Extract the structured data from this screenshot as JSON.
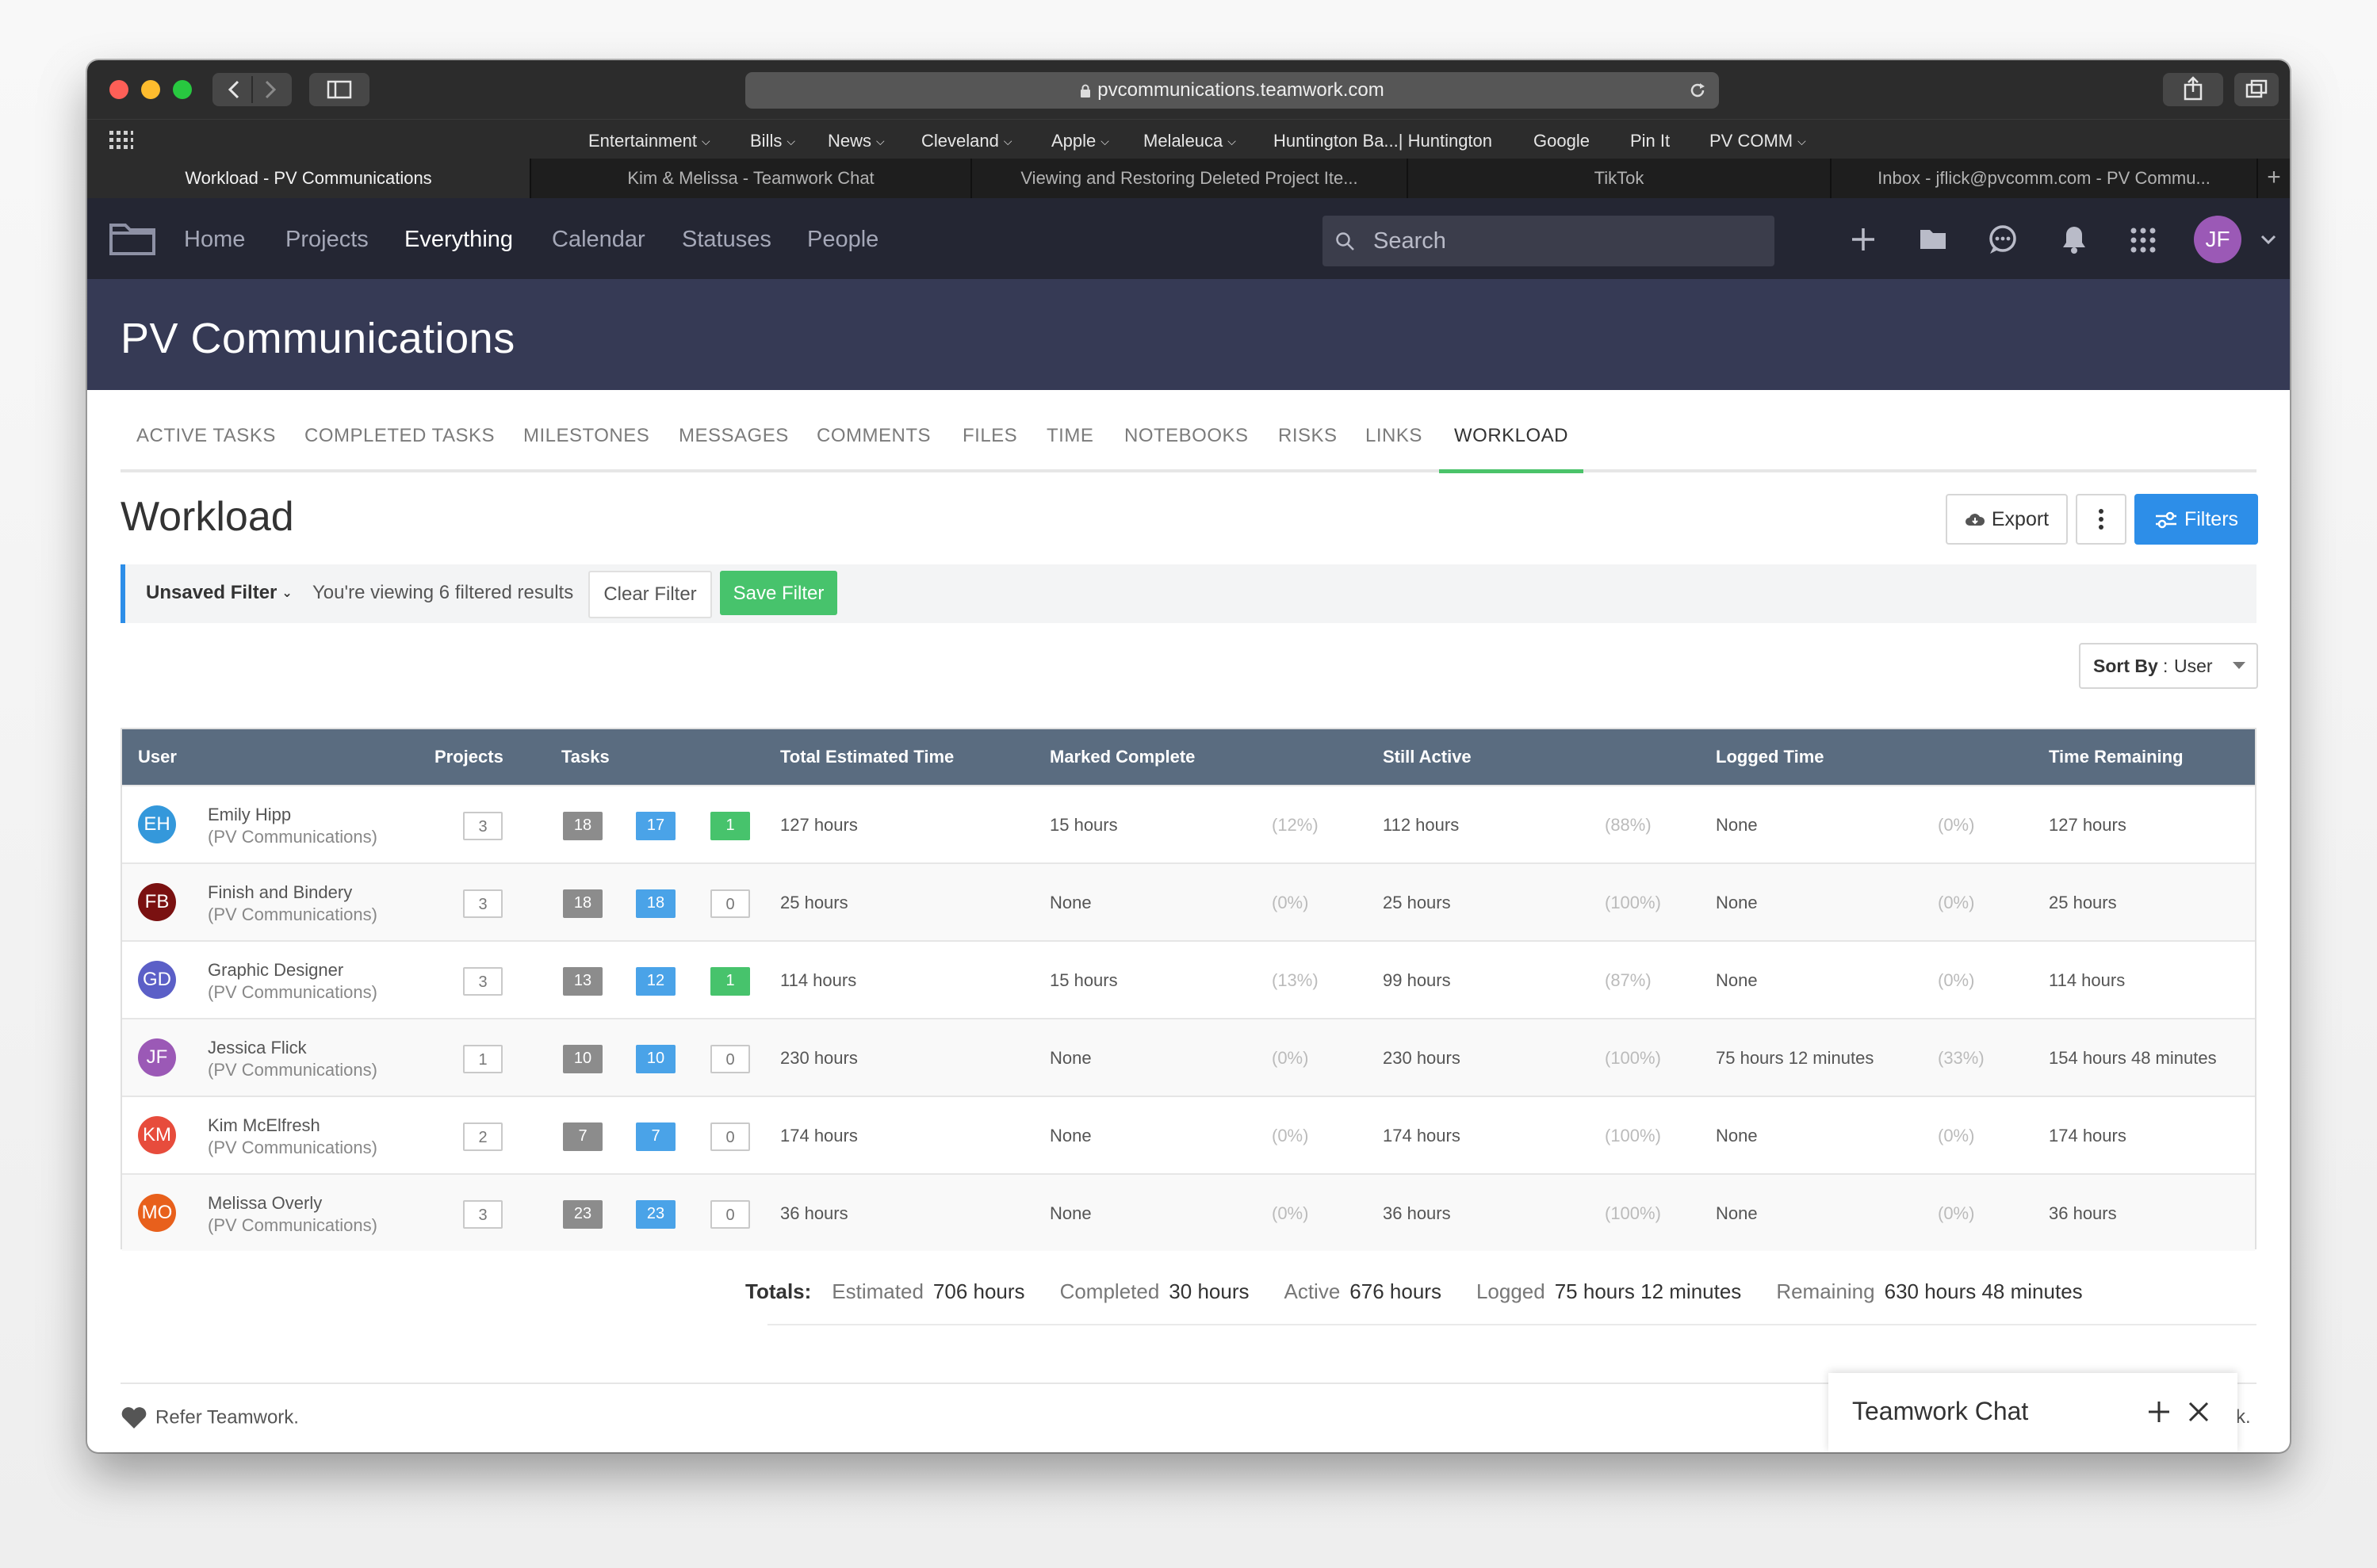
{
  "browser": {
    "url": "pvcommunications.teamwork.com",
    "bookmarks": [
      {
        "label": "Entertainment",
        "menu": true
      },
      {
        "label": "Bills",
        "menu": true
      },
      {
        "label": "News",
        "menu": true
      },
      {
        "label": "Cleveland",
        "menu": true
      },
      {
        "label": "Apple",
        "menu": true
      },
      {
        "label": "Melaleuca",
        "menu": true
      },
      {
        "label": "Huntington Ba...| Huntington",
        "menu": false
      },
      {
        "label": "Google",
        "menu": false
      },
      {
        "label": "Pin It",
        "menu": false
      },
      {
        "label": "PV COMM",
        "menu": true
      }
    ],
    "tabs": [
      {
        "label": "Workload - PV Communications",
        "active": true
      },
      {
        "label": "Kim & Melissa - Teamwork Chat",
        "active": false
      },
      {
        "label": "Viewing and Restoring Deleted Project Ite...",
        "active": false
      },
      {
        "label": "TikTok",
        "active": false
      },
      {
        "label": "Inbox - jflick@pvcomm.com - PV Commu...",
        "active": false
      }
    ]
  },
  "nav": {
    "links": [
      {
        "label": "Home",
        "active": false
      },
      {
        "label": "Projects",
        "active": false
      },
      {
        "label": "Everything",
        "active": true
      },
      {
        "label": "Calendar",
        "active": false
      },
      {
        "label": "Statuses",
        "active": false
      },
      {
        "label": "People",
        "active": false
      }
    ],
    "search_placeholder": "Search",
    "avatar_initials": "JF"
  },
  "project": {
    "title": "PV Communications",
    "tabs": [
      {
        "label": "ACTIVE TASKS",
        "active": false
      },
      {
        "label": "COMPLETED TASKS",
        "active": false
      },
      {
        "label": "MILESTONES",
        "active": false
      },
      {
        "label": "MESSAGES",
        "active": false
      },
      {
        "label": "COMMENTS",
        "active": false
      },
      {
        "label": "FILES",
        "active": false
      },
      {
        "label": "TIME",
        "active": false
      },
      {
        "label": "NOTEBOOKS",
        "active": false
      },
      {
        "label": "RISKS",
        "active": false
      },
      {
        "label": "LINKS",
        "active": false
      },
      {
        "label": "WORKLOAD",
        "active": true
      }
    ]
  },
  "workload": {
    "title": "Workload",
    "export_label": "Export",
    "filters_label": "Filters",
    "filter_name": "Unsaved Filter",
    "filter_text": "You're viewing 6 filtered results",
    "clear_filter": "Clear Filter",
    "save_filter": "Save Filter",
    "sort_by_label": "Sort By",
    "sort_by_value": "User"
  },
  "table": {
    "headers": [
      "User",
      "Projects",
      "Tasks",
      "Total Estimated Time",
      "Marked Complete",
      "Still Active",
      "Logged Time",
      "Time Remaining"
    ],
    "rows": [
      {
        "initials": "EH",
        "color": "#3498db",
        "name": "Emily Hipp",
        "company": "(PV Communications)",
        "projects": "3",
        "tasks_total": "18",
        "tasks_active": "17",
        "tasks_done": "1",
        "estimated": "127 hours",
        "complete": "15 hours",
        "complete_pct": "(12%)",
        "active": "112 hours",
        "active_pct": "(88%)",
        "logged": "None",
        "logged_pct": "(0%)",
        "remaining": "127 hours"
      },
      {
        "initials": "FB",
        "color": "#7a1111",
        "name": "Finish and Bindery",
        "company": "(PV Communications)",
        "projects": "3",
        "tasks_total": "18",
        "tasks_active": "18",
        "tasks_done": "0",
        "estimated": "25 hours",
        "complete": "None",
        "complete_pct": "(0%)",
        "active": "25 hours",
        "active_pct": "(100%)",
        "logged": "None",
        "logged_pct": "(0%)",
        "remaining": "25 hours"
      },
      {
        "initials": "GD",
        "color": "#5b5fc7",
        "name": "Graphic Designer",
        "company": "(PV Communications)",
        "projects": "3",
        "tasks_total": "13",
        "tasks_active": "12",
        "tasks_done": "1",
        "estimated": "114 hours",
        "complete": "15 hours",
        "complete_pct": "(13%)",
        "active": "99 hours",
        "active_pct": "(87%)",
        "logged": "None",
        "logged_pct": "(0%)",
        "remaining": "114 hours"
      },
      {
        "initials": "JF",
        "color": "#9b59b6",
        "name": "Jessica Flick",
        "company": "(PV Communications)",
        "projects": "1",
        "tasks_total": "10",
        "tasks_active": "10",
        "tasks_done": "0",
        "estimated": "230 hours",
        "complete": "None",
        "complete_pct": "(0%)",
        "active": "230 hours",
        "active_pct": "(100%)",
        "logged": "75 hours 12 minutes",
        "logged_pct": "(33%)",
        "remaining": "154 hours 48 minutes"
      },
      {
        "initials": "KM",
        "color": "#e74c3c",
        "name": "Kim McElfresh",
        "company": "(PV Communications)",
        "projects": "2",
        "tasks_total": "7",
        "tasks_active": "7",
        "tasks_done": "0",
        "estimated": "174 hours",
        "complete": "None",
        "complete_pct": "(0%)",
        "active": "174 hours",
        "active_pct": "(100%)",
        "logged": "None",
        "logged_pct": "(0%)",
        "remaining": "174 hours"
      },
      {
        "initials": "MO",
        "color": "#e8601c",
        "name": "Melissa Overly",
        "company": "(PV Communications)",
        "projects": "3",
        "tasks_total": "23",
        "tasks_active": "23",
        "tasks_done": "0",
        "estimated": "36 hours",
        "complete": "None",
        "complete_pct": "(0%)",
        "active": "36 hours",
        "active_pct": "(100%)",
        "logged": "None",
        "logged_pct": "(0%)",
        "remaining": "36 hours"
      }
    ]
  },
  "totals": {
    "label": "Totals:",
    "estimated_label": "Estimated",
    "estimated": "706 hours",
    "completed_label": "Completed",
    "completed": "30 hours",
    "active_label": "Active",
    "active": "676 hours",
    "logged_label": "Logged",
    "logged": "75 hours 12 minutes",
    "remaining_label": "Remaining",
    "remaining": "630 hours 48 minutes"
  },
  "footer": {
    "refer": "Refer Teamwork.",
    "tail": "rk.",
    "chat_title": "Teamwork Chat"
  }
}
